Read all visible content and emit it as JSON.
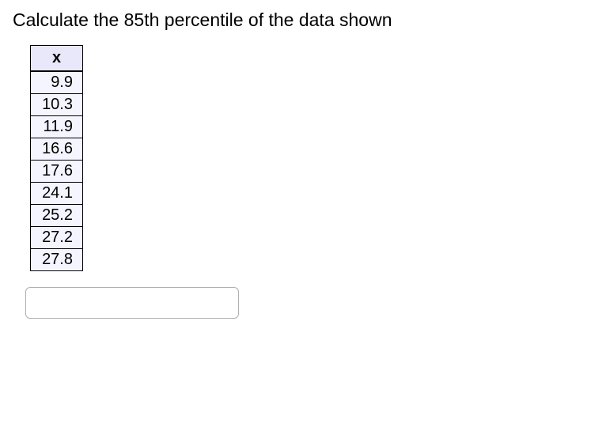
{
  "question": "Calculate the 85th percentile of the data shown",
  "table": {
    "header": "x",
    "values": [
      "9.9",
      "10.3",
      "11.9",
      "16.6",
      "17.6",
      "24.1",
      "25.2",
      "27.2",
      "27.8"
    ]
  },
  "answer": {
    "value": "",
    "placeholder": ""
  }
}
